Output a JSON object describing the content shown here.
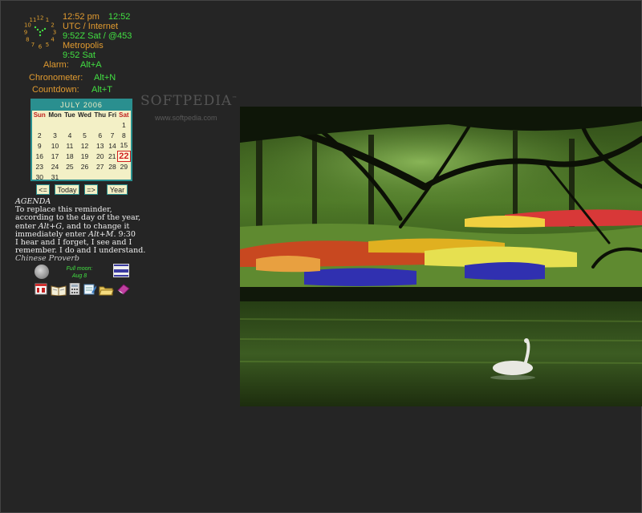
{
  "clock": {
    "hours": [
      "12",
      "1",
      "2",
      "3",
      "4",
      "5",
      "6",
      "7",
      "8",
      "9",
      "10",
      "11"
    ]
  },
  "time": {
    "local_time": "12:52 pm",
    "local_time_alt": "12:52",
    "zone_label": "UTC / Internet",
    "utc_line": "9:52Z  Sat / @453",
    "city": "Metropolis",
    "city_line": "9:52  Sat"
  },
  "hotkeys": {
    "alarm": {
      "label": "Alarm:",
      "key": "Alt+A"
    },
    "chronometer": {
      "label": "Chronometer:",
      "key": "Alt+N"
    },
    "countdown": {
      "label": "Countdown:",
      "key": "Alt+T"
    }
  },
  "calendar": {
    "month_label": "JULY 2006",
    "weekdays": [
      "Sun",
      "Mon",
      "Tue",
      "Wed",
      "Thu",
      "Fri",
      "Sat"
    ],
    "weeks": [
      [
        "",
        "",
        "",
        "",
        "",
        "",
        "1"
      ],
      [
        "2",
        "3",
        "4",
        "5",
        "6",
        "7",
        "8"
      ],
      [
        "9",
        "10",
        "11",
        "12",
        "13",
        "14",
        "15"
      ],
      [
        "16",
        "17",
        "18",
        "19",
        "20",
        "21",
        "22"
      ],
      [
        "23",
        "24",
        "25",
        "26",
        "27",
        "28",
        "29"
      ],
      [
        "30",
        "31",
        "",
        "",
        "",
        "",
        ""
      ]
    ],
    "today": "22",
    "buttons": {
      "prev": "<=",
      "today": "Today",
      "next": "=>",
      "year": "Year"
    }
  },
  "agenda": {
    "title": "AGENDA",
    "line1": "To replace this reminder, according to the day of the year, enter ",
    "line1_key": "Alt+G",
    "line2": ", and to change it immediately enter ",
    "line2_key": "Alt+M",
    "line2_tail": ". 9:30",
    "quote": "I hear and I forget, I see and I remember. I do and I understand.",
    "source": "Chinese Proverb"
  },
  "moon": {
    "label": "Full moon:",
    "date": "Aug 8"
  },
  "watermark": {
    "brand": "SOFTPEDIA",
    "tm": "™",
    "url": "www.softpedia.com"
  },
  "colors": {
    "background": "#252525",
    "orange": "#e09a30",
    "green": "#42e042",
    "calendar_bg": "#f3f0c6",
    "teal": "#2a8f8f"
  },
  "tray_icons": [
    "calendar-page-icon",
    "open-book-icon",
    "calculator-icon",
    "notepad-icon",
    "folder-open-icon",
    "eraser-icon"
  ]
}
